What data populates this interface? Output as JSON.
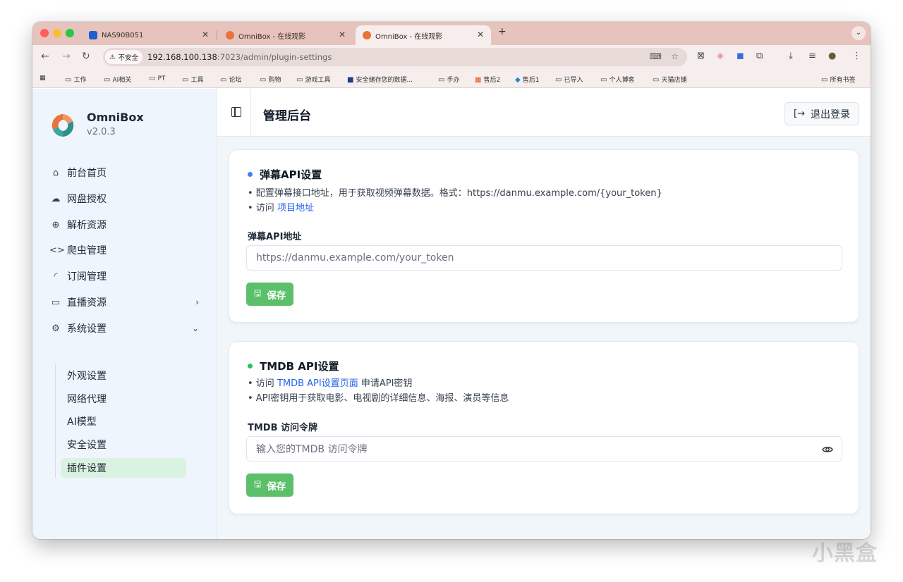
{
  "browser": {
    "tabs": [
      {
        "title": "NAS90B051",
        "favicon_color": "#1f5fd0"
      },
      {
        "title": "OmniBox - 在线观影",
        "favicon_color": "#e8733c"
      },
      {
        "title": "OmniBox - 在线观影",
        "favicon_color": "#e8733c"
      }
    ],
    "new_tab": "+",
    "security_chip": "不安全",
    "url_host": "192.168.100.138",
    "url_rest": ":7023/admin/plugin-settings",
    "bookmarks": [
      "工作",
      "AI相关",
      "PT",
      "工具",
      "论坛",
      "购物",
      "游戏工具",
      "安全储存您的数据...",
      "手办",
      "售后2",
      "售后1",
      "已导入",
      "个人博客",
      "天猫店铺"
    ],
    "all_bookmarks": "所有书签"
  },
  "sidebar": {
    "brand_name": "OmniBox",
    "version": "v2.0.3",
    "items": [
      {
        "label": "前台首页",
        "icon": "home-icon"
      },
      {
        "label": "网盘授权",
        "icon": "cloud-icon"
      },
      {
        "label": "解析资源",
        "icon": "globe-icon"
      },
      {
        "label": "爬虫管理",
        "icon": "code-icon"
      },
      {
        "label": "订阅管理",
        "icon": "rss-icon"
      },
      {
        "label": "直播资源",
        "icon": "tv-icon"
      },
      {
        "label": "系统设置",
        "icon": "gear-icon"
      }
    ],
    "sub_items": [
      "外观设置",
      "网络代理",
      "AI模型",
      "安全设置",
      "插件设置"
    ]
  },
  "header": {
    "title": "管理后台",
    "logout_label": "退出登录"
  },
  "danmu": {
    "title": "弹幕API设置",
    "line1": "• 配置弹幕接口地址，用于获取视频弹幕数据。格式：https://danmu.example.com/{your_token}",
    "line2_prefix": "• 访问 ",
    "line2_link": "项目地址",
    "field_label": "弹幕API地址",
    "placeholder": "https://danmu.example.com/your_token",
    "save_label": "保存",
    "dot_color": "#3b82f6"
  },
  "tmdb": {
    "title": "TMDB API设置",
    "line1_prefix": "• 访问 ",
    "line1_link": "TMDB API设置页面",
    "line1_suffix": " 申请API密钥",
    "line2": "• API密钥用于获取电影、电视剧的详细信息、海报、演员等信息",
    "field_label": "TMDB 访问令牌",
    "placeholder": "输入您的TMDB 访问令牌",
    "save_label": "保存",
    "dot_color": "#22c55e"
  },
  "watermark": "小黑盒"
}
